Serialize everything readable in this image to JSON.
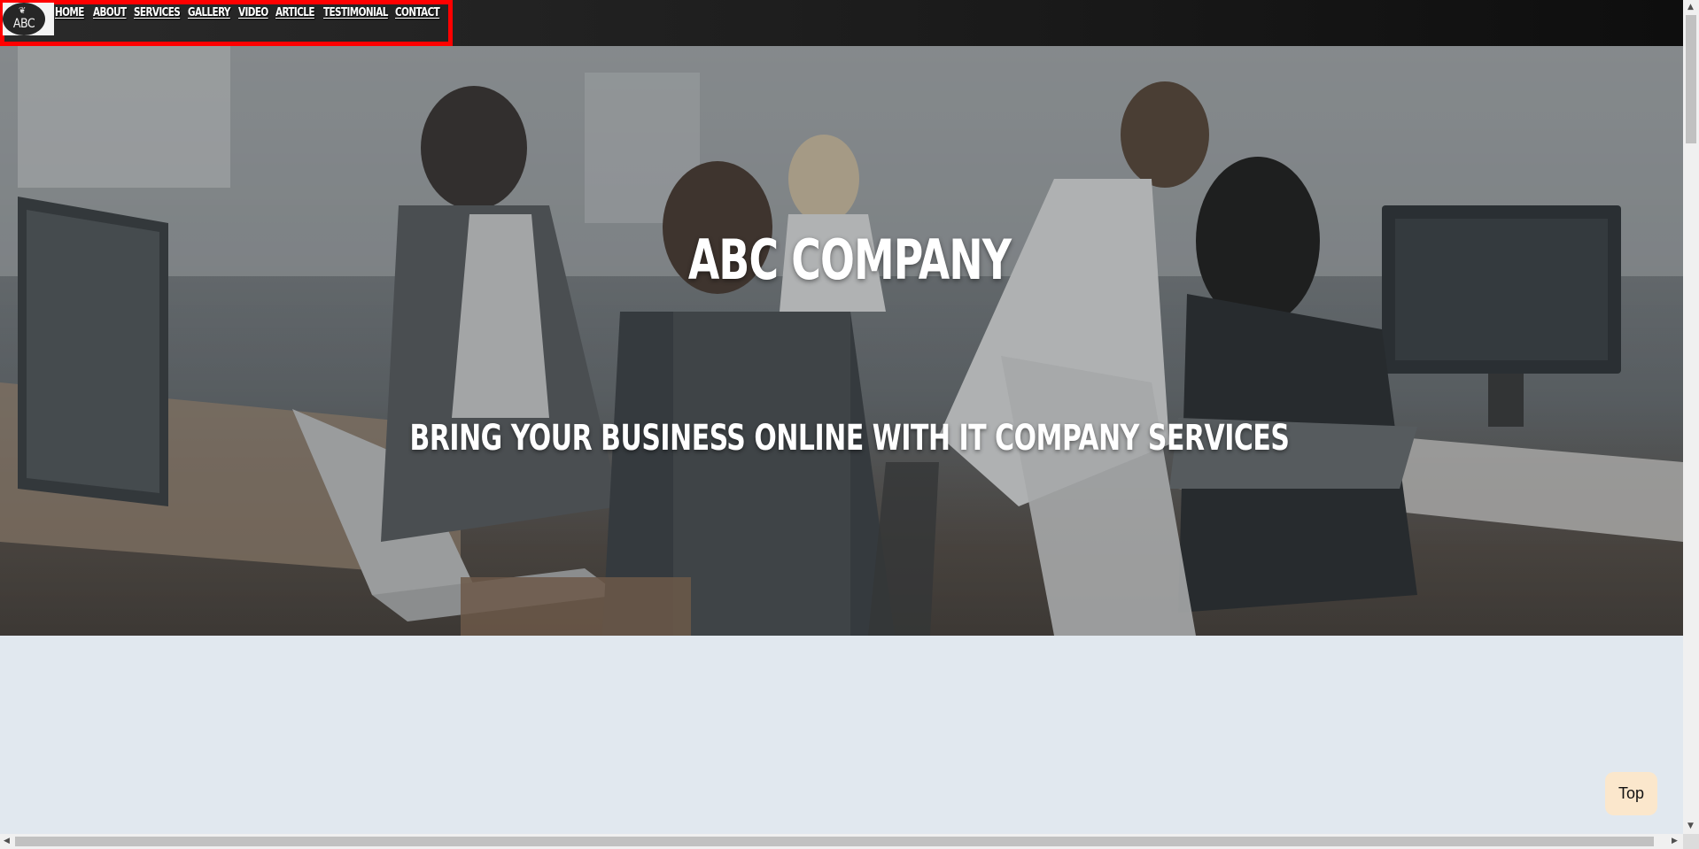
{
  "logo": {
    "text": "ABC",
    "leaf_glyph": "❦"
  },
  "nav": {
    "items": [
      "HOME",
      "ABOUT",
      "SERVICES",
      "GALLERY",
      "VIDEO",
      "ARTICLE",
      "TESTIMONIAL",
      "CONTACT"
    ]
  },
  "hero": {
    "title": "ABC COMPANY",
    "subtitle": "BRING YOUR BUSINESS ONLINE WITH IT COMPANY SERVICES",
    "image_subject": "office-team-photo"
  },
  "top_button": {
    "label": "Top"
  },
  "scrollbars": {
    "up": "▲",
    "down": "▼",
    "left": "◀",
    "right": "▶"
  },
  "colors": {
    "nav_highlight": "#ff0000",
    "page_background": "#e1e8ef",
    "top_button_bg": "#fbe7cc"
  }
}
